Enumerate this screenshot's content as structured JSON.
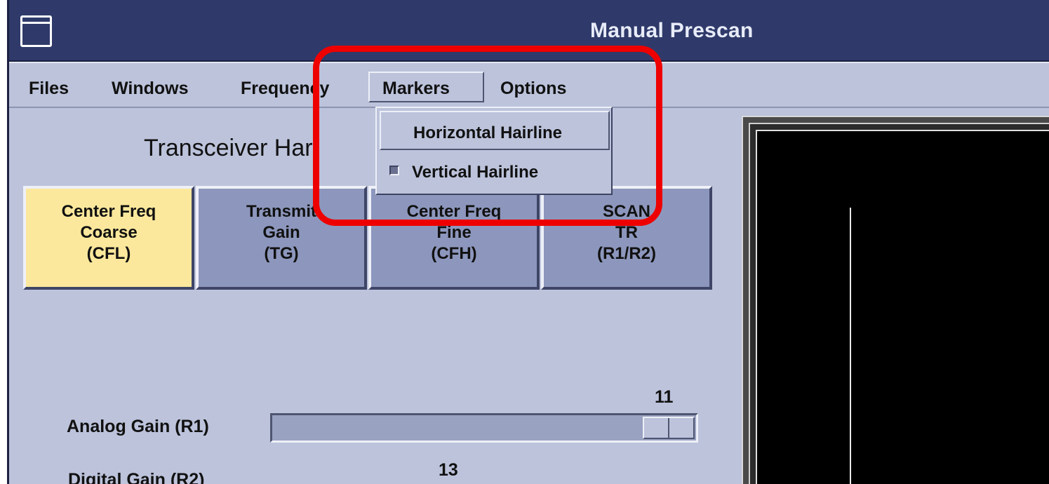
{
  "window": {
    "title": "Manual Prescan"
  },
  "menubar": {
    "items": [
      {
        "label": "Files",
        "mnemonic": "F"
      },
      {
        "label": "Windows",
        "mnemonic": "W"
      },
      {
        "label": "Frequency",
        "mnemonic": "F"
      },
      {
        "label": "Markers",
        "mnemonic": "M",
        "open": true
      },
      {
        "label": "Options",
        "mnemonic": "O"
      }
    ]
  },
  "markers_menu": {
    "items": [
      {
        "label": "Horizontal Hairline",
        "checked": false
      },
      {
        "label": "Vertical Hairline",
        "checked": true
      }
    ]
  },
  "panel": {
    "section_title": "Transceiver Har"
  },
  "param_buttons": [
    {
      "lines": [
        "Center Freq",
        "Coarse",
        "(CFL)"
      ],
      "selected": true
    },
    {
      "lines": [
        "Transmit",
        "Gain",
        "(TG)"
      ],
      "selected": false
    },
    {
      "lines": [
        "Center Freq",
        "Fine",
        "(CFH)"
      ],
      "selected": false
    },
    {
      "lines": [
        "SCAN",
        "TR",
        "(R1/R2)"
      ],
      "selected": false
    }
  ],
  "sliders": {
    "analog_gain": {
      "label": "Analog Gain (R1)",
      "value": "11"
    },
    "digital_gain": {
      "label": "Digital Gain (R2)",
      "value": "13"
    }
  },
  "colors": {
    "window_bg": "#bcc3db",
    "titlebar": "#2f3a6a",
    "selected_button": "#fbe89c",
    "button": "#8d97bd",
    "annotation": "#ee0000"
  }
}
